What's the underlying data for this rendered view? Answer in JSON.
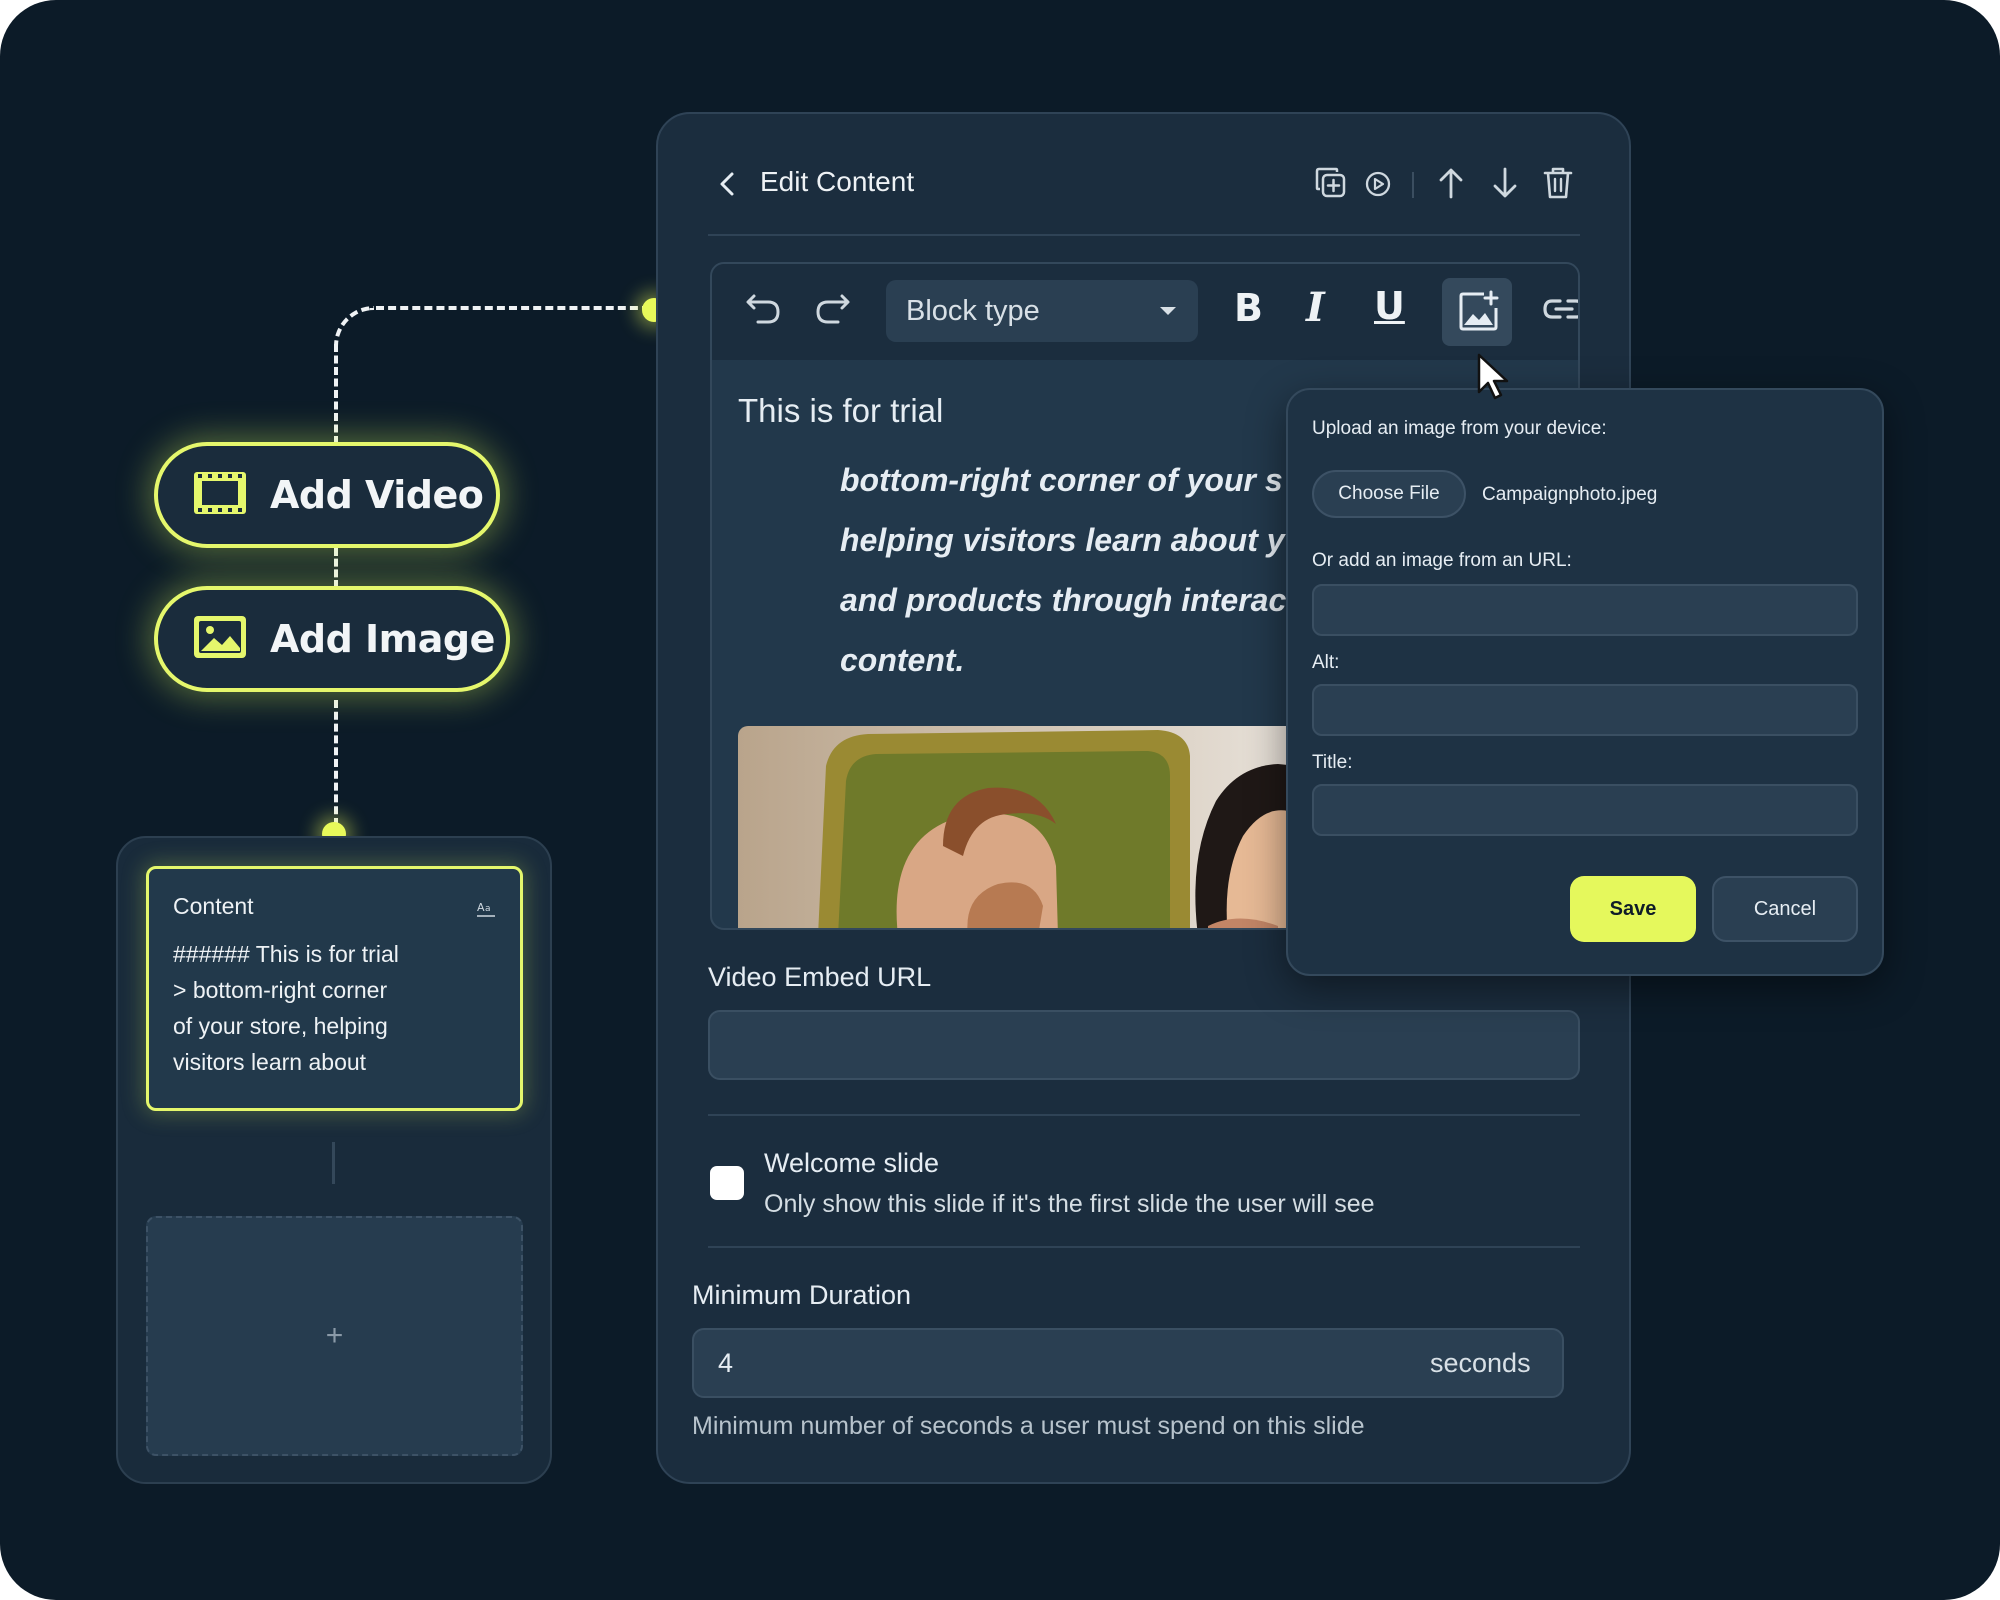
{
  "flow": {
    "add_video_label": "Add Video",
    "add_image_label": "Add Image",
    "content_card": {
      "title": "Content",
      "body": "###### This is for trial\n> bottom-right corner\nof your store, helping\nvisitors learn about"
    },
    "add_slot_label": "+"
  },
  "editor": {
    "title": "Edit Content",
    "header_icons": [
      "duplicate-icon",
      "play-icon",
      "arrow-up-icon",
      "arrow-down-icon",
      "trash-icon"
    ],
    "toolbar": {
      "block_type_label": "Block type",
      "bold": "B",
      "italic": "I",
      "underline": "U",
      "icons": [
        "undo-icon",
        "redo-icon",
        "image-add-icon",
        "link-icon"
      ]
    },
    "document": {
      "heading": "This is for trial",
      "quote": "bottom-right corner of your s\nhelping visitors learn about y\nand products through interac\ncontent."
    },
    "video_embed": {
      "label": "Video Embed URL",
      "value": ""
    },
    "welcome_slide": {
      "title": "Welcome slide",
      "description": "Only show this slide if it's the first slide the user will see",
      "checked": false
    },
    "minimum_duration": {
      "label": "Minimum Duration",
      "value": "4",
      "unit": "seconds",
      "help": "Minimum number of seconds a user must spend on this slide"
    }
  },
  "upload_popover": {
    "device_label": "Upload an image from your device:",
    "choose_file_label": "Choose File",
    "file_name": "Campaignphoto.jpeg",
    "url_label": "Or add an image from an URL:",
    "url_value": "",
    "alt_label": "Alt:",
    "alt_value": "",
    "title_label": "Title:",
    "title_value": "",
    "save_label": "Save",
    "cancel_label": "Cancel"
  },
  "colors": {
    "background": "#0c1b28",
    "panel": "#1b2d3e",
    "accent": "#e5f85c"
  }
}
